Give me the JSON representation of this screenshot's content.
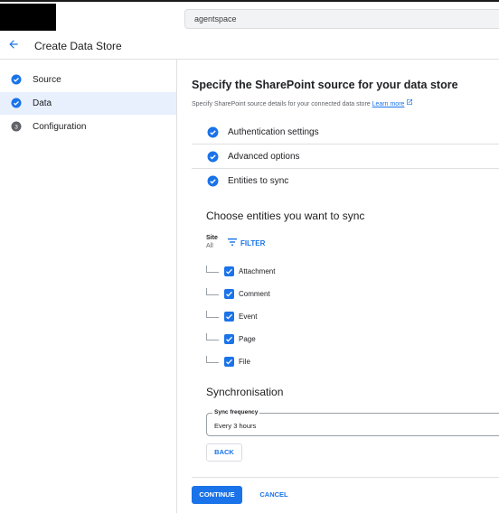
{
  "search": {
    "value": "agentspace"
  },
  "header": {
    "title": "Create Data Store"
  },
  "sidebar": {
    "steps": [
      {
        "label": "Source",
        "state": "done"
      },
      {
        "label": "Data",
        "state": "done-active"
      },
      {
        "label": "Configuration",
        "state": "pending",
        "number": "3"
      }
    ]
  },
  "main": {
    "title": "Specify the SharePoint source for your data store",
    "subtitle": "Specify SharePoint source details for your connected data store",
    "learn_more": "Learn more",
    "sections": [
      {
        "label": "Authentication settings"
      },
      {
        "label": "Advanced options"
      },
      {
        "label": "Entities to sync"
      }
    ],
    "entities_heading": "Choose entities you want to sync",
    "site_label": "Site",
    "site_value": "All",
    "filter_label": "FILTER",
    "entities": [
      {
        "label": "Attachment",
        "checked": true
      },
      {
        "label": "Comment",
        "checked": true
      },
      {
        "label": "Event",
        "checked": true
      },
      {
        "label": "Page",
        "checked": true
      },
      {
        "label": "File",
        "checked": true
      }
    ],
    "sync_heading": "Synchronisation",
    "sync_field_label": "Sync frequency",
    "sync_field_value": "Every 3 hours",
    "back_label": "BACK",
    "continue_label": "CONTINUE",
    "cancel_label": "CANCEL"
  },
  "colors": {
    "accent": "#1a73e8",
    "step_active_bg": "#e8f0fe",
    "pending_step": "#5f6368"
  }
}
